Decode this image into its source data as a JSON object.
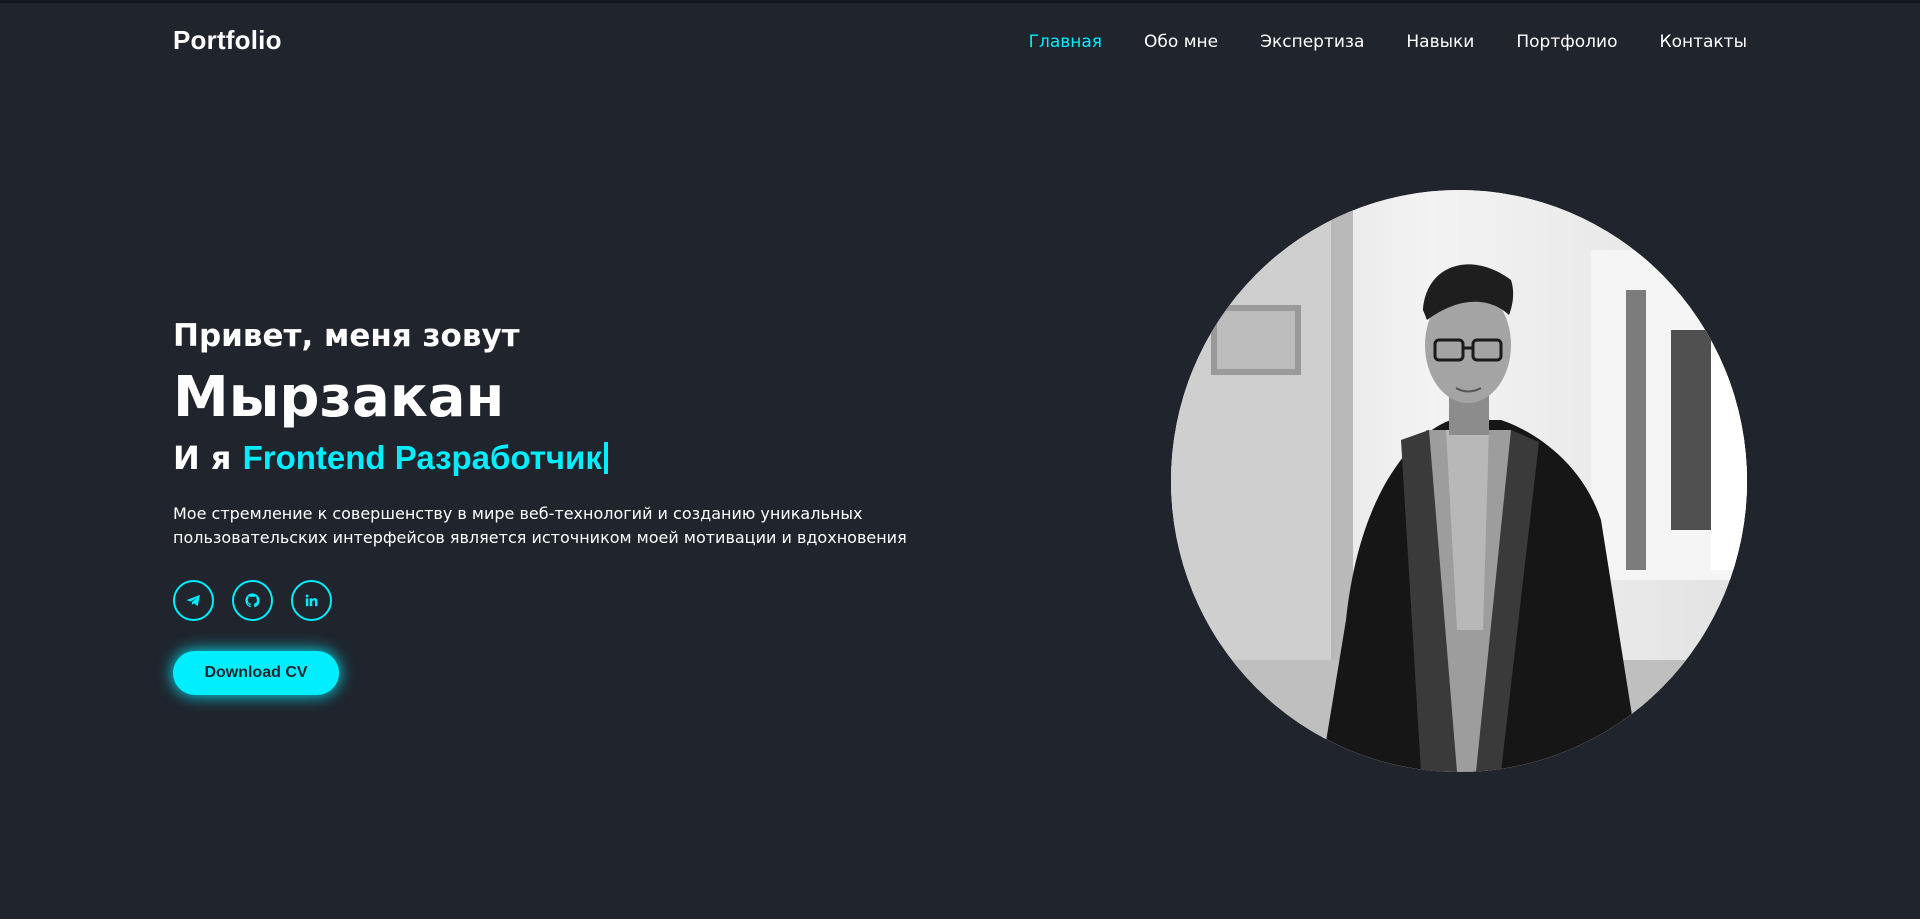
{
  "header": {
    "logo": "Portfolio",
    "nav": [
      {
        "label": "Главная",
        "active": true
      },
      {
        "label": "Обо мне"
      },
      {
        "label": "Экспертиза"
      },
      {
        "label": "Навыки"
      },
      {
        "label": "Портфолио"
      },
      {
        "label": "Контакты"
      }
    ]
  },
  "hero": {
    "greeting": "Привет, меня зовут",
    "name": "Мырзакан",
    "role_prefix": "И я",
    "role_accent": "Frontend Разработчик",
    "description": "Мое стремление к совершенству в мире веб-технологий и созданию уникальных пользовательских интерфейсов является источником моей мотивации и вдохновения",
    "socials": [
      {
        "icon": "telegram-icon"
      },
      {
        "icon": "github-icon"
      },
      {
        "icon": "linkedin-icon"
      }
    ],
    "cv_button": "Download CV"
  },
  "colors": {
    "background": "#1f242d",
    "accent": "#00eeff",
    "text": "#ffffff"
  }
}
